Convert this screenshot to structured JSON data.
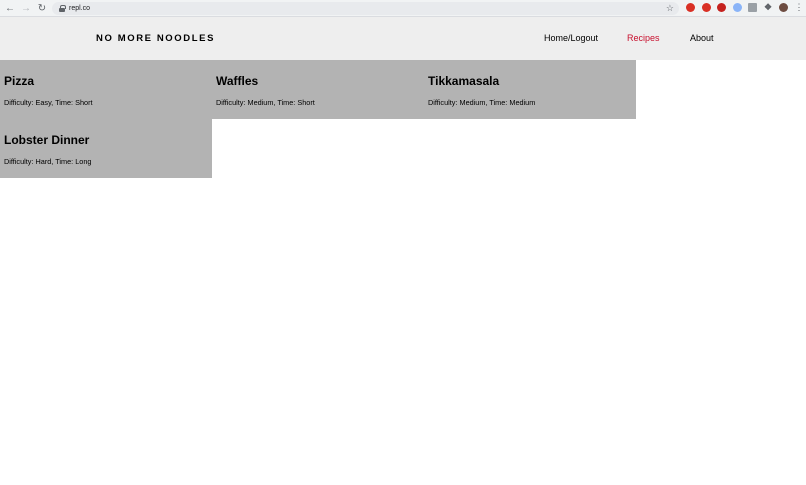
{
  "browser": {
    "url": "repl.co",
    "icons": {
      "back": "back-arrow-icon",
      "forward": "forward-arrow-icon",
      "reload": "reload-icon",
      "lock": "lock-icon",
      "star": "bookmark-star-icon",
      "extensions": "puzzle-icon",
      "menu": "kebab-menu-icon"
    },
    "extension_colors": [
      "#d93025",
      "#d93025",
      "#c5221f",
      "#8ab4f8",
      "#5f6368",
      "#5f6368"
    ]
  },
  "site": {
    "brand": "NO MORE NOODLES",
    "nav": [
      {
        "label": "Home/Logout",
        "active": false
      },
      {
        "label": "Recipes",
        "active": true
      },
      {
        "label": "About",
        "active": false
      }
    ],
    "accent_color": "#c8102e",
    "card_color": "#b3b3b3",
    "header_color": "#eeeeee"
  },
  "recipes": [
    {
      "title": "Pizza",
      "meta": "Difficulty: Easy, Time: Short"
    },
    {
      "title": "Waffles",
      "meta": "Difficulty: Medium, Time: Short"
    },
    {
      "title": "Tikkamasala",
      "meta": "Difficulty: Medium, Time: Medium"
    },
    {
      "title": "Lobster Dinner",
      "meta": "Difficulty: Hard, Time: Long"
    }
  ]
}
